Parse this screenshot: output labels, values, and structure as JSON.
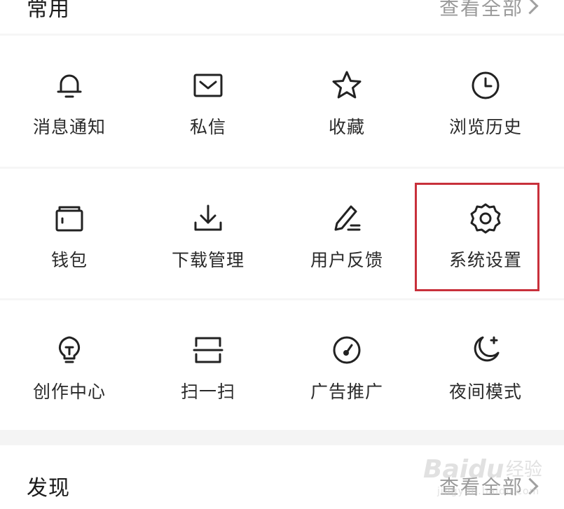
{
  "top_section": {
    "title": "常用",
    "view_all": "查看全部"
  },
  "grid": {
    "rows": [
      [
        {
          "label": "消息通知",
          "icon": "bell-icon"
        },
        {
          "label": "私信",
          "icon": "mail-icon"
        },
        {
          "label": "收藏",
          "icon": "star-icon"
        },
        {
          "label": "浏览历史",
          "icon": "clock-icon"
        }
      ],
      [
        {
          "label": "钱包",
          "icon": "wallet-icon"
        },
        {
          "label": "下载管理",
          "icon": "download-icon"
        },
        {
          "label": "用户反馈",
          "icon": "pencil-icon"
        },
        {
          "label": "系统设置",
          "icon": "gear-icon"
        }
      ],
      [
        {
          "label": "创作中心",
          "icon": "lightbulb-icon"
        },
        {
          "label": "扫一扫",
          "icon": "scan-icon"
        },
        {
          "label": "广告推广",
          "icon": "gauge-icon"
        },
        {
          "label": "夜间模式",
          "icon": "moon-icon"
        }
      ]
    ]
  },
  "bottom_section": {
    "title": "发现",
    "view_all": "查看全部"
  },
  "watermark": {
    "brand": "Baidu",
    "suffix": "经验",
    "url": "jingyan.baidu.com"
  },
  "colors": {
    "highlight": "#c8303b",
    "icon_stroke": "#222222",
    "muted_text": "#9a9a9a"
  }
}
